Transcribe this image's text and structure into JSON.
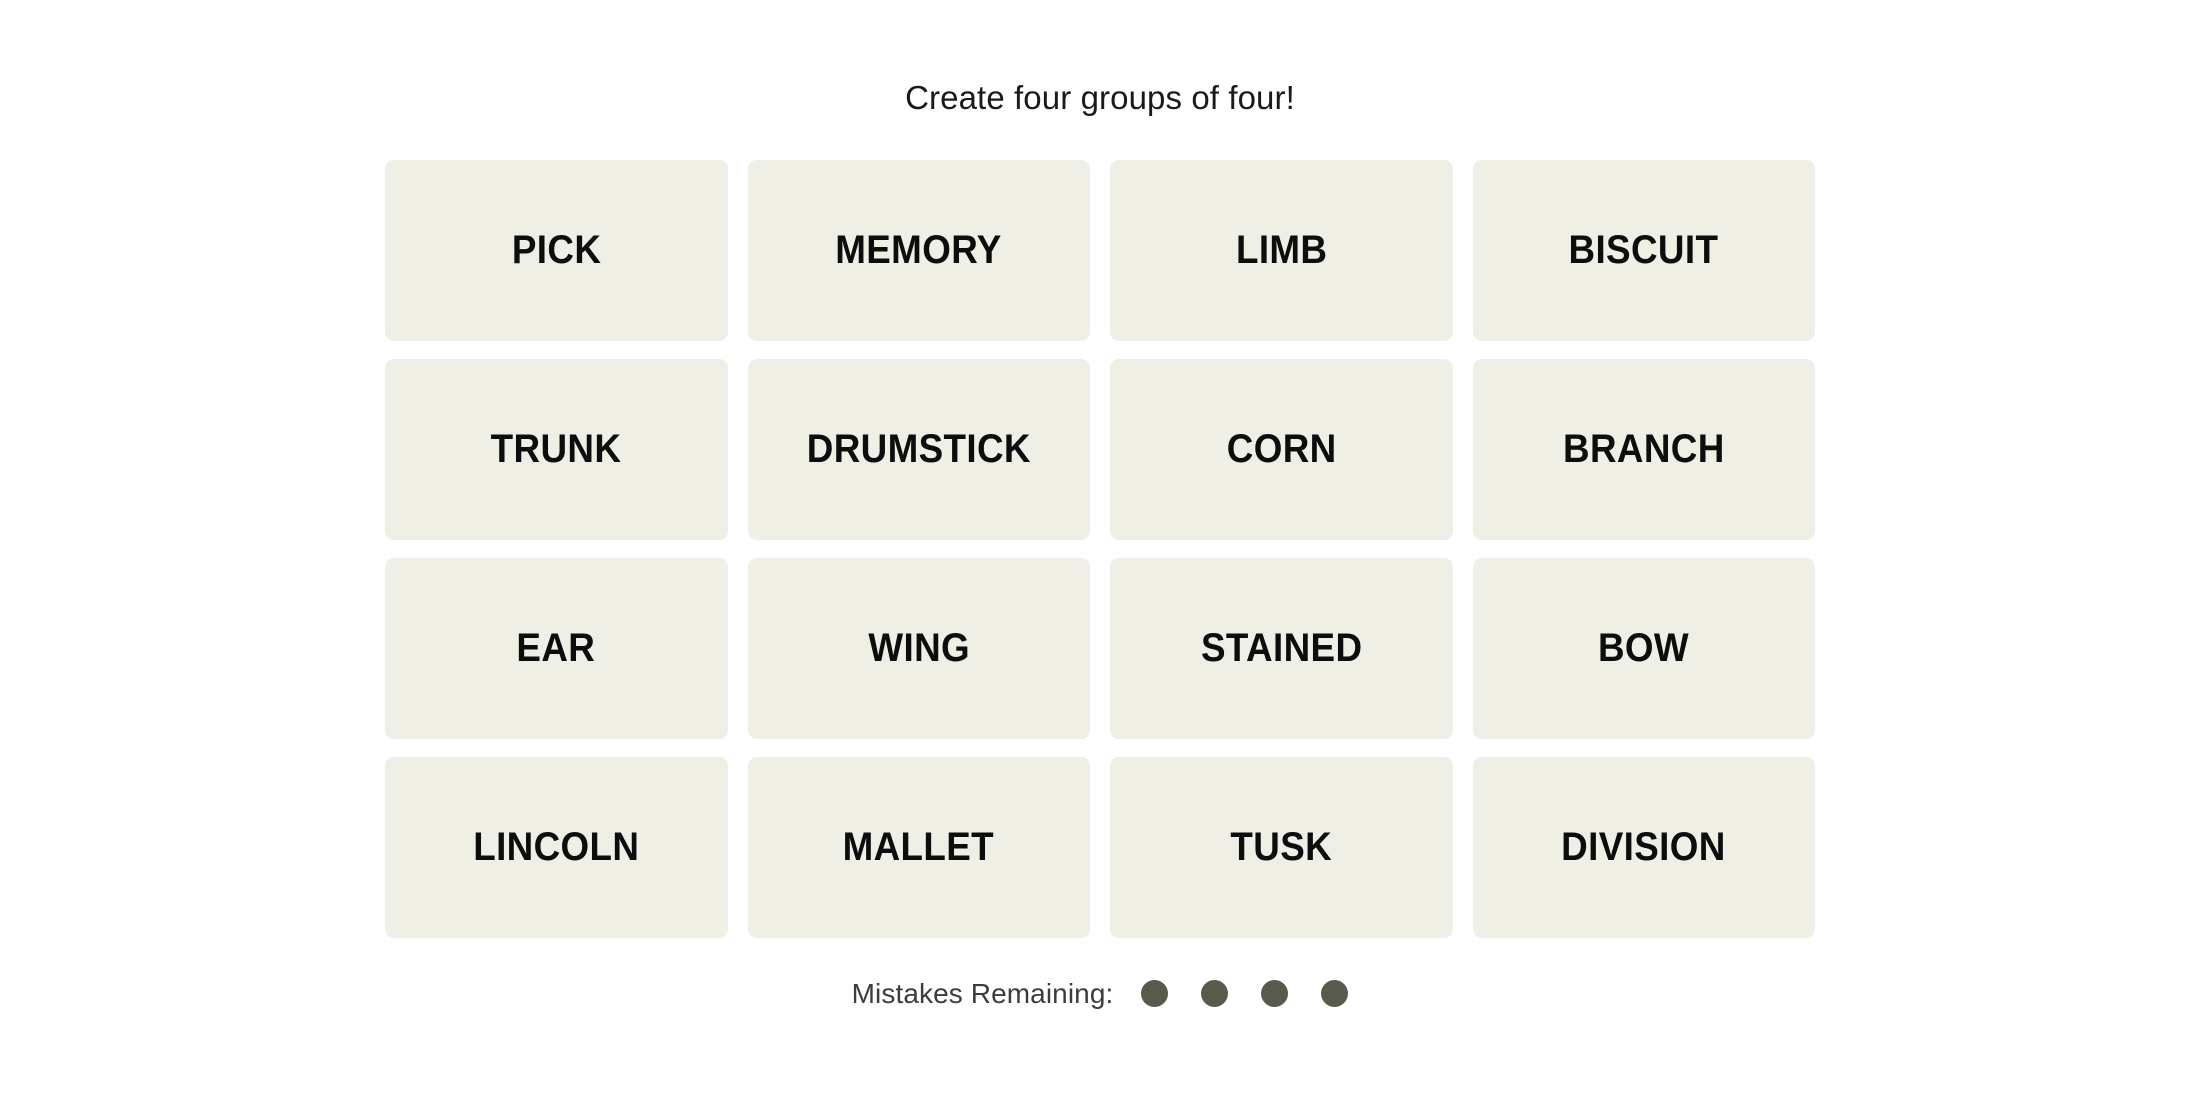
{
  "game": {
    "title": "Create four groups of four!",
    "tile_bg_color": "#EFEFE6",
    "tile_text_color": "#0D0D0D",
    "page_bg_color": "#FFFFFF",
    "grid": {
      "columns": 4,
      "rows": 4,
      "tiles": [
        {
          "label": "PICK",
          "row": 1,
          "col": 1,
          "selected": false
        },
        {
          "label": "MEMORY",
          "row": 1,
          "col": 2,
          "selected": false
        },
        {
          "label": "LIMB",
          "row": 1,
          "col": 3,
          "selected": false
        },
        {
          "label": "BISCUIT",
          "row": 1,
          "col": 4,
          "selected": false
        },
        {
          "label": "TRUNK",
          "row": 2,
          "col": 1,
          "selected": false
        },
        {
          "label": "DRUMSTICK",
          "row": 2,
          "col": 2,
          "selected": false
        },
        {
          "label": "CORN",
          "row": 2,
          "col": 3,
          "selected": false
        },
        {
          "label": "BRANCH",
          "row": 2,
          "col": 4,
          "selected": false
        },
        {
          "label": "EAR",
          "row": 3,
          "col": 1,
          "selected": false
        },
        {
          "label": "WING",
          "row": 3,
          "col": 2,
          "selected": false
        },
        {
          "label": "STAINED",
          "row": 3,
          "col": 3,
          "selected": false
        },
        {
          "label": "BOW",
          "row": 3,
          "col": 4,
          "selected": false
        },
        {
          "label": "LINCOLN",
          "row": 4,
          "col": 1,
          "selected": false
        },
        {
          "label": "MALLET",
          "row": 4,
          "col": 2,
          "selected": false
        },
        {
          "label": "TUSK",
          "row": 4,
          "col": 3,
          "selected": false
        },
        {
          "label": "DIVISION",
          "row": 4,
          "col": 4,
          "selected": false
        }
      ]
    },
    "mistakes": {
      "label": "Mistakes Remaining:",
      "remaining": 4,
      "dot_color": "#5A5A4C",
      "dots": [
        {
          "used": false
        },
        {
          "used": false
        },
        {
          "used": false
        },
        {
          "used": false
        }
      ]
    }
  }
}
